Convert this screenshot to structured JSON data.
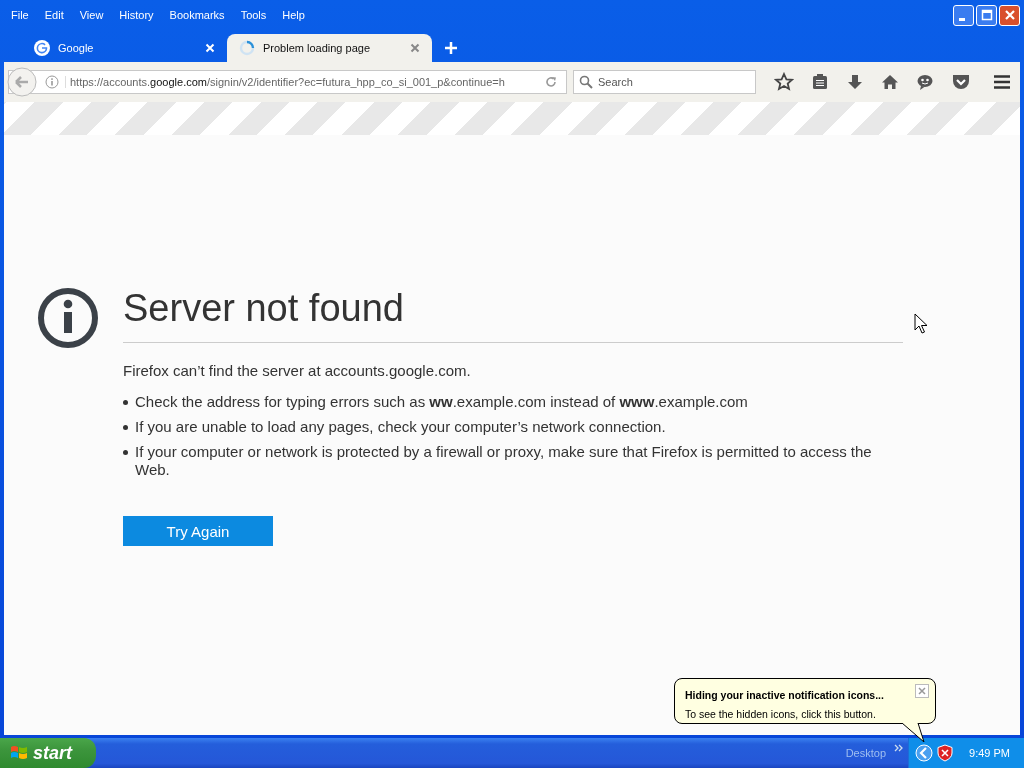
{
  "menu": [
    "File",
    "Edit",
    "View",
    "History",
    "Bookmarks",
    "Tools",
    "Help"
  ],
  "tabs": [
    {
      "label": "Google",
      "selected": false,
      "kind": "google"
    },
    {
      "label": "Problem loading page",
      "selected": true,
      "kind": "loading"
    }
  ],
  "url": "https://accounts.**google.com**/signin/v2/identifier?ec=futura_hpp_co_si_001_p&continue=h",
  "search": {
    "placeholder": "Search"
  },
  "error": {
    "title": "Server not found",
    "message": "Firefox can’t find the server at accounts.google.com.",
    "bullets": [
      "Check the address for typing errors such as **ww**.example.com instead of **www**.example.com",
      "If you are unable to load any pages, check your computer’s network connection.",
      "If your computer or network is protected by a firewall or proxy, make sure that Firefox is permitted to access the Web."
    ],
    "button": "Try Again"
  },
  "balloon": {
    "title": "Hiding your inactive notification icons...",
    "text": "To see the hidden icons, click this button."
  },
  "taskbar": {
    "start": "start",
    "toolbar": "Desktop",
    "clock": "9:49 PM"
  }
}
